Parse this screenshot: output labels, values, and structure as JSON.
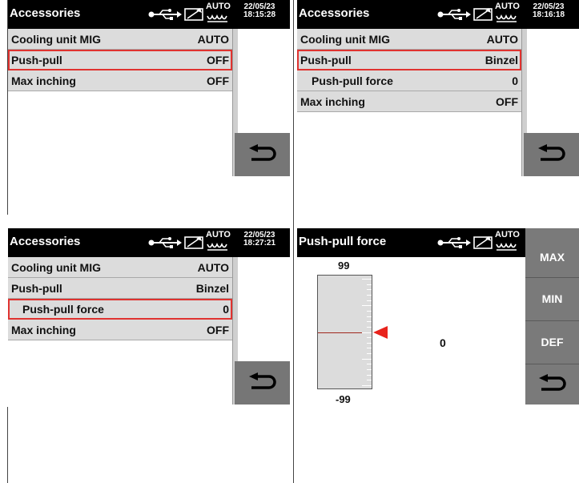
{
  "screens": [
    {
      "title": "Accessories",
      "date": "22/05/23",
      "time": "18:15:28",
      "auto": "AUTO",
      "items": [
        {
          "label": "Cooling unit MIG",
          "value": "AUTO"
        },
        {
          "label": "Push-pull",
          "value": "OFF",
          "selected": true
        },
        {
          "label": "Max inching",
          "value": "OFF"
        }
      ]
    },
    {
      "title": "Accessories",
      "date": "22/05/23",
      "time": "18:16:18",
      "auto": "AUTO",
      "items": [
        {
          "label": "Cooling unit MIG",
          "value": "AUTO"
        },
        {
          "label": "Push-pull",
          "value": "Binzel",
          "selected": true
        },
        {
          "label": "Push-pull force",
          "value": "0",
          "sub": true
        },
        {
          "label": "Max inching",
          "value": "OFF"
        }
      ]
    },
    {
      "title": "Accessories",
      "date": "22/05/23",
      "time": "18:27:21",
      "auto": "AUTO",
      "items": [
        {
          "label": "Cooling unit MIG",
          "value": "AUTO"
        },
        {
          "label": "Push-pull",
          "value": "Binzel"
        },
        {
          "label": "Push-pull force",
          "value": "0",
          "sub": true,
          "selected": true
        },
        {
          "label": "Max inching",
          "value": "OFF"
        }
      ]
    }
  ],
  "adjust": {
    "title": "Push-pull force",
    "auto": "AUTO",
    "max_label": "99",
    "min_label": "-99",
    "value": "0",
    "range_min": -99,
    "range_max": 99,
    "current": 0,
    "buttons": {
      "max": "MAX",
      "min": "MIN",
      "def": "DEF"
    }
  },
  "icons": [
    "usb-icon",
    "manual-mode-icon",
    "wave-icon",
    "back-arrow-icon",
    "red-pointer-icon"
  ],
  "colors": {
    "titlebar": "#000000",
    "row": "#dcdcdc",
    "selection": "#e03330",
    "button": "#767676",
    "pointer": "#e8231c"
  }
}
